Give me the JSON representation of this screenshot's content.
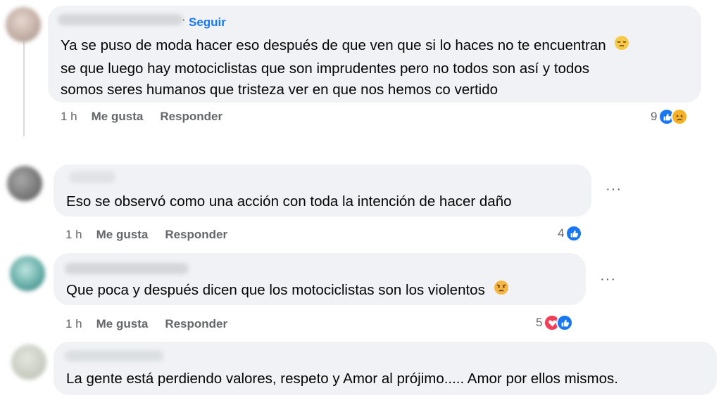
{
  "comments": [
    {
      "follow_label": "Seguir",
      "separator": "·",
      "lines": [
        "Ya se puso de moda hacer eso después de que ven que si lo haces no te encuentran",
        "se que luego hay motociclistas que son imprudentes pero no todos son así y todos",
        "somos seres humanos que tristeza ver en que nos hemos co vertido"
      ],
      "trailing_emoji": "pensive-face-emoji",
      "time": "1 h",
      "like_label": "Me gusta",
      "reply_label": "Responder",
      "reaction_count": "9",
      "reactions": [
        "like",
        "sad"
      ]
    },
    {
      "lines": [
        "Eso se observó como una acción con toda la intención de hacer daño"
      ],
      "time": "1 h",
      "like_label": "Me gusta",
      "reply_label": "Responder",
      "reaction_count": "4",
      "reactions": [
        "like"
      ],
      "more_label": "···"
    },
    {
      "lines": [
        "Que poca y después dicen que los motociclistas son los violentos"
      ],
      "trailing_emoji": "angry-face-emoji",
      "time": "1 h",
      "like_label": "Me gusta",
      "reply_label": "Responder",
      "reaction_count": "5",
      "reactions": [
        "love",
        "like"
      ],
      "more_label": "···"
    },
    {
      "lines": [
        "La gente está perdiendo valores, respeto y Amor al prójimo..... Amor por ellos mismos."
      ]
    }
  ],
  "colors": {
    "like": "#1877f2",
    "love": "#f33e58",
    "sad": "#f7b125",
    "bubble": "#f0f2f5",
    "meta": "#65676b"
  }
}
